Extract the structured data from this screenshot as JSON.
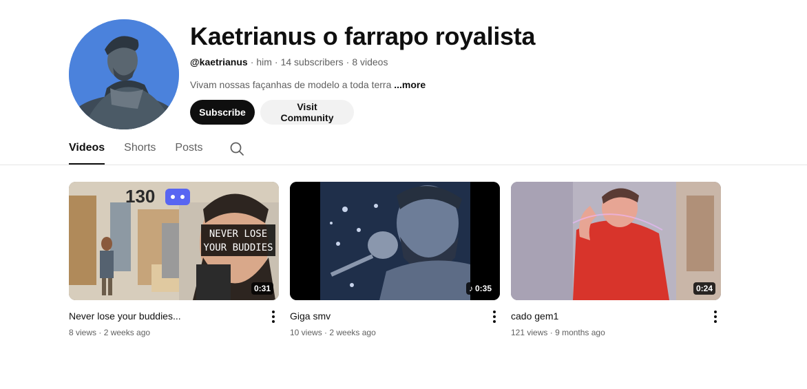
{
  "channel": {
    "name": "Kaetrianus o farrapo royalista",
    "handle": "@kaetrianus",
    "pronoun": "him",
    "subscribers": "14 subscribers",
    "video_count": "8 videos",
    "description": "Vivam nossas façanhas de modelo a toda terra",
    "more_label": "...more",
    "separator": "·"
  },
  "actions": {
    "subscribe_label": "Subscribe",
    "community_label": "Visit Community"
  },
  "tabs": [
    {
      "label": "Videos",
      "active": true
    },
    {
      "label": "Shorts",
      "active": false
    },
    {
      "label": "Posts",
      "active": false
    }
  ],
  "videos": [
    {
      "title": "Never lose your buddies...",
      "views": "8 views",
      "age": "2 weeks ago",
      "duration": "0:31",
      "music": false,
      "thumb_text_1": "NEVER LOSE",
      "thumb_text_2": "YOUR BUDDIES",
      "thumb_number": "130"
    },
    {
      "title": "Giga smv",
      "views": "10 views",
      "age": "2 weeks ago",
      "duration": "0:35",
      "music": true
    },
    {
      "title": "cado gem1",
      "views": "121 views",
      "age": "9 months ago",
      "duration": "0:24",
      "music": false
    }
  ],
  "icons": {
    "search": "search-icon",
    "more": "more-vert-icon",
    "music": "music-note-icon"
  },
  "colors": {
    "subscribe_bg": "#0f0f0f",
    "community_bg": "#f2f2f2",
    "secondary_text": "#606060"
  }
}
